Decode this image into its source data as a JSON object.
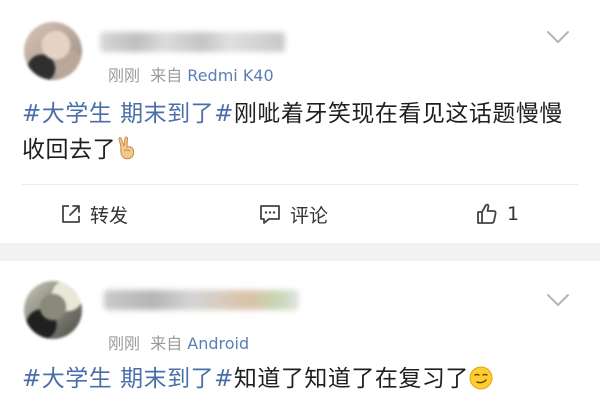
{
  "posts": [
    {
      "timestamp": "刚刚",
      "source_prefix": "来自",
      "device": "Redmi K40",
      "hashtag": "#大学生 期末到了#",
      "text": "刚呲着牙笑现在看见这话题慢慢收回去了",
      "emoji": "victory-hand-emoji",
      "actions": {
        "repost_label": "转发",
        "comment_label": "评论",
        "like_count": "1"
      }
    },
    {
      "timestamp": "刚刚",
      "source_prefix": "来自",
      "device": "Android",
      "hashtag": "#大学生 期末到了#",
      "text": "知道了知道了在复习了",
      "emoji": "smirking-face-emoji"
    }
  ],
  "colors": {
    "hashtag": "#4a6fa8",
    "device": "#5a7fb5",
    "meta": "#9b9b9b",
    "separator": "#f2f2f2"
  }
}
